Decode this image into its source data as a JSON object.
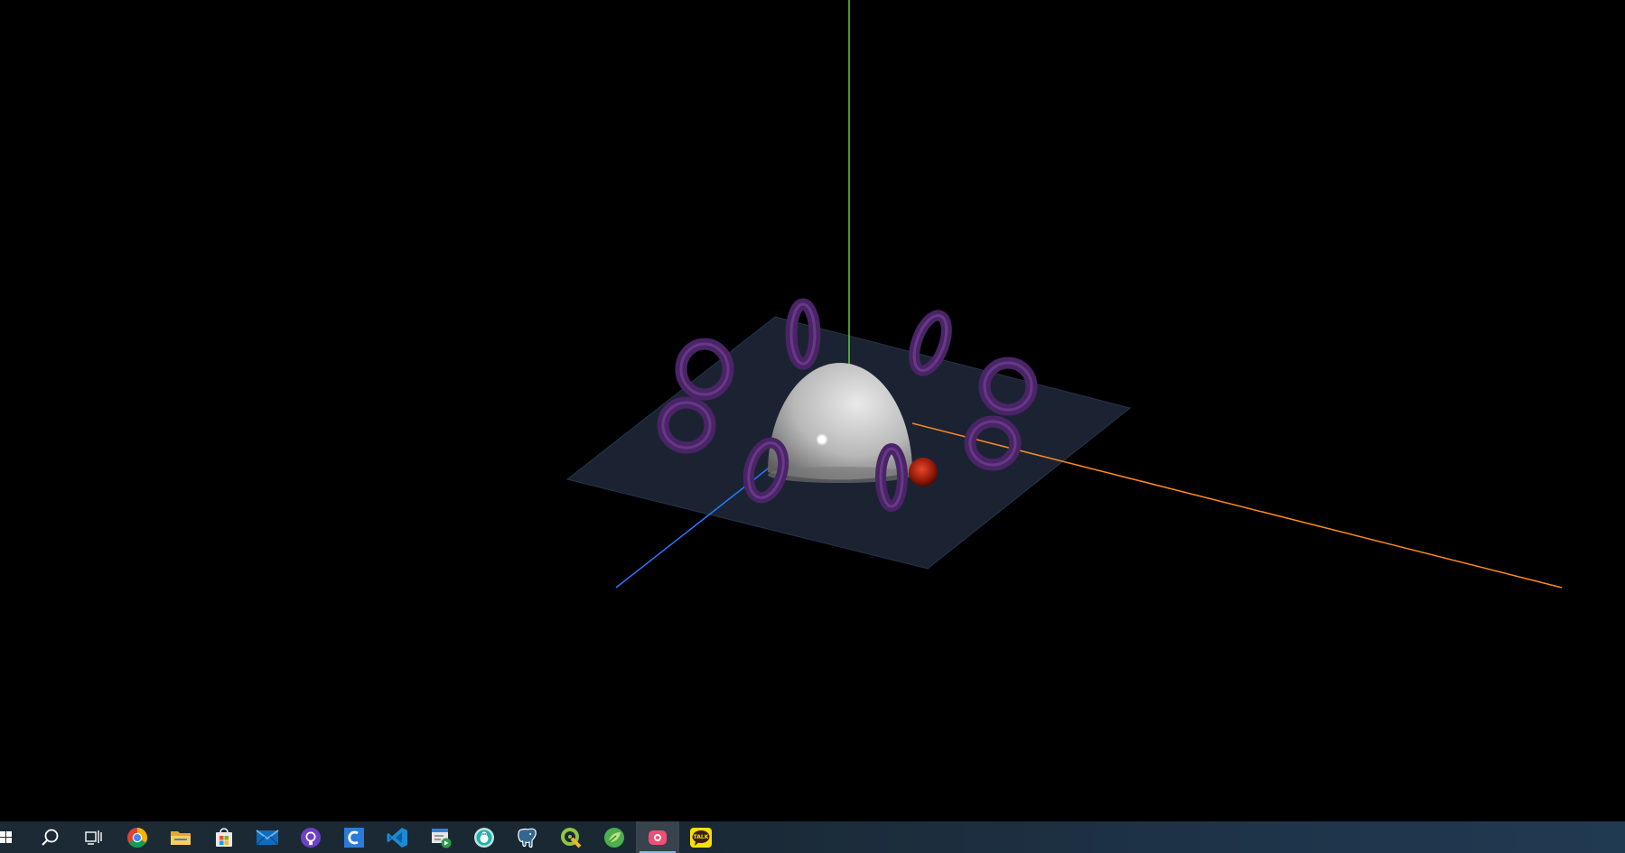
{
  "scene": {
    "name": "three-js-3d-viewport",
    "colors": {
      "background": "#000000",
      "ground_plane": "#1b2333",
      "hemisphere": "#d8d8d8",
      "torus": "#5a2a7a",
      "small_sphere": "#b8200e",
      "axis_x": "#ff8a1e",
      "axis_y": "#66cc33",
      "axis_z": "#2a78ff",
      "light_point": "#ffffff"
    },
    "objects": [
      "ground-plane",
      "hemisphere",
      "torus",
      "torus",
      "torus",
      "torus",
      "torus",
      "torus",
      "torus",
      "torus",
      "small-red-sphere",
      "axis-x",
      "axis-y",
      "axis-z",
      "point-light"
    ]
  },
  "taskbar": {
    "items": [
      {
        "icon": "windows-start-icon",
        "color": "#ffffff"
      },
      {
        "icon": "search-icon",
        "color": "#ffffff"
      },
      {
        "icon": "task-view-icon",
        "color": "#ffffff"
      },
      {
        "icon": "chrome-icon",
        "color": "#4285f4"
      },
      {
        "icon": "file-explorer-icon",
        "color": "#f4c542"
      },
      {
        "icon": "microsoft-store-icon",
        "color": "#0078d4"
      },
      {
        "icon": "mail-icon",
        "color": "#0f6cbd"
      },
      {
        "icon": "github-desktop-icon",
        "color": "#6e40c9"
      },
      {
        "icon": "c-app-icon",
        "color": "#2b7bd8"
      },
      {
        "icon": "vscode-icon",
        "color": "#2a9df4"
      },
      {
        "icon": "app-window-icon",
        "color": "#3a7bd5"
      },
      {
        "icon": "bug-app-icon",
        "color": "#20b2aa"
      },
      {
        "icon": "postgresql-icon",
        "color": "#8cb4e6"
      },
      {
        "icon": "qgis-icon",
        "color": "#91c443"
      },
      {
        "icon": "green-app-icon",
        "color": "#4caf50"
      },
      {
        "icon": "screen-recorder-icon",
        "color": "#ef4f73"
      },
      {
        "icon": "kakaotalk-icon",
        "color": "#f9e000"
      }
    ],
    "active_index": 15,
    "kakaotalk_label": "TALK"
  }
}
